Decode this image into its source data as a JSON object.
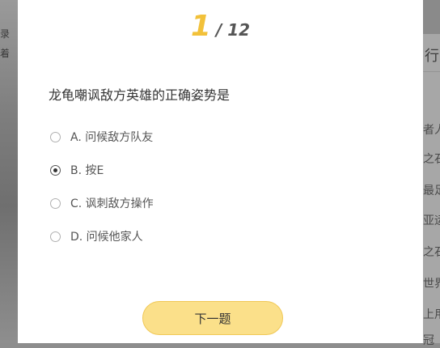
{
  "progress": {
    "current": "1",
    "total": "/ 12"
  },
  "question": "龙龟嘲讽敌方英雄的正确姿势是",
  "options": [
    {
      "label": "A. 问候敌方队友",
      "selected": false
    },
    {
      "label": "B. 按E",
      "selected": true
    },
    {
      "label": "C. 讽刺敌方操作",
      "selected": false
    },
    {
      "label": "D. 问候他家人",
      "selected": false
    }
  ],
  "next_button": "下一题",
  "background": {
    "left": [
      "录",
      "着"
    ],
    "right": [
      "行",
      "者人",
      "之石",
      "最足",
      "亚运",
      "之石",
      "世界",
      "上用",
      "冠"
    ]
  }
}
